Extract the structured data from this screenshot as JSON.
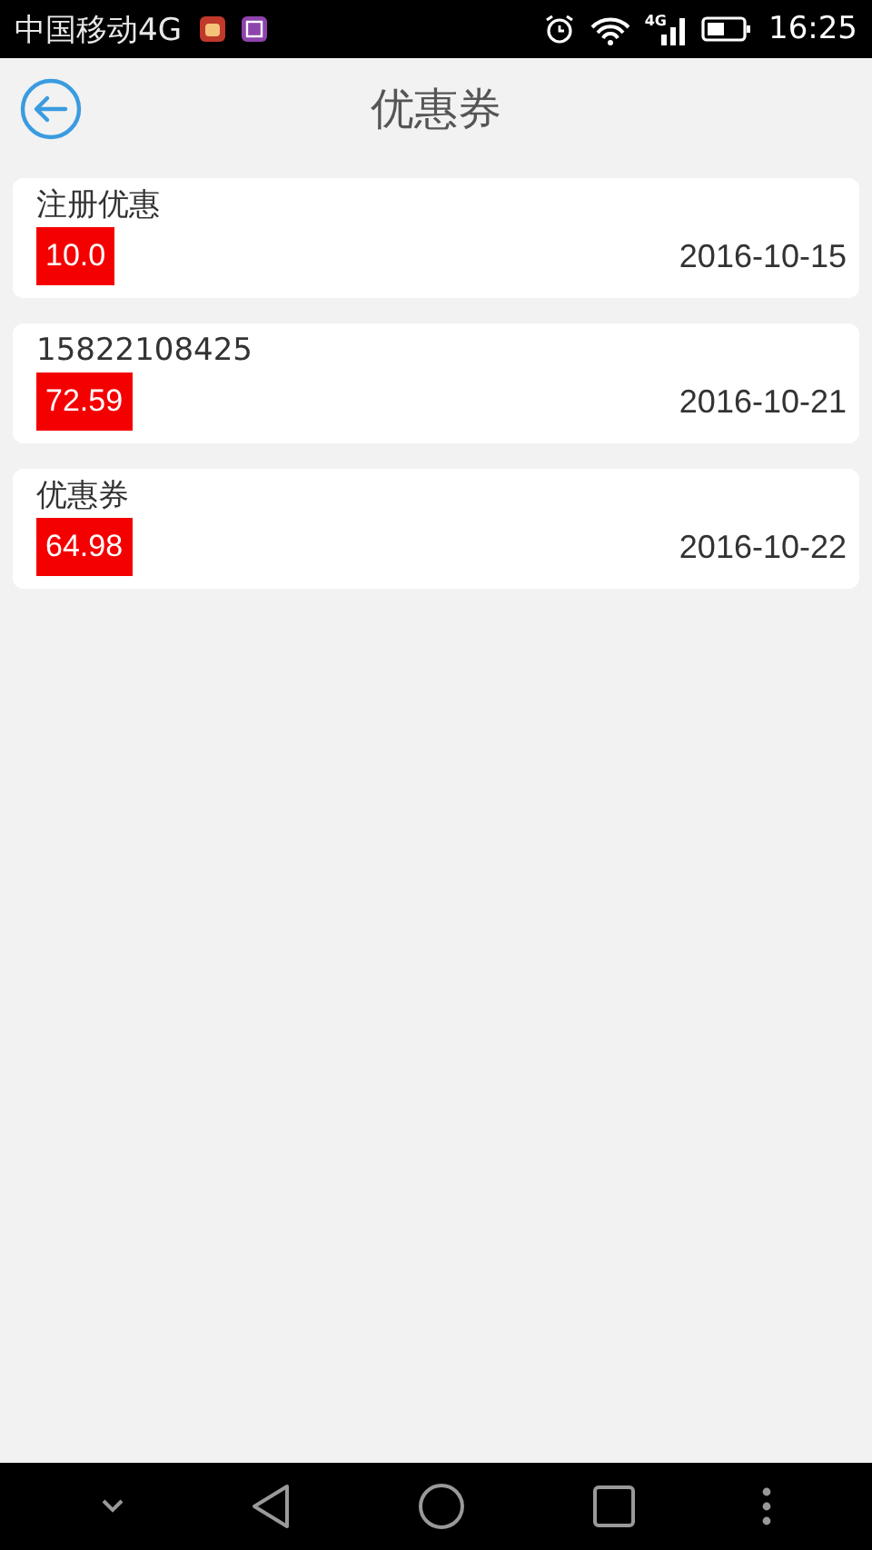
{
  "status_bar": {
    "carrier": "中国移动4G",
    "network_badge": "4G",
    "time": "16:25"
  },
  "header": {
    "title": "优惠券"
  },
  "coupons": [
    {
      "name": "注册优惠",
      "amount": "10.0",
      "date": "2016-10-15"
    },
    {
      "name": "15822108425",
      "amount": "72.59",
      "date": "2016-10-21"
    },
    {
      "name": "优惠券",
      "amount": "64.98",
      "date": "2016-10-22"
    }
  ]
}
